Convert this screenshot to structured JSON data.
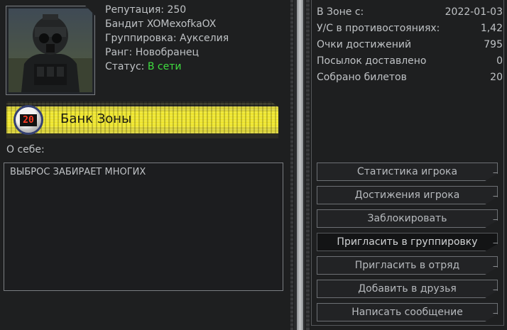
{
  "profile": {
    "reputation_label": "Репутация:",
    "reputation_value": "250",
    "name_line": "Бандит XOMexofkaOX",
    "faction_label": "Группировка:",
    "faction_value": "Аукселия",
    "rank_label": "Ранг:",
    "rank_value": "Новобранец",
    "status_label": "Статус:",
    "status_value": "В сети"
  },
  "bank": {
    "badge_number": "20",
    "label": "Банк Зоны"
  },
  "about": {
    "label": "О себе:",
    "text": "ВЫБРОС ЗАБИРАЕТ МНОГИХ"
  },
  "stats": [
    {
      "label": "В Зоне с:",
      "value": "2022-01-03"
    },
    {
      "label": "У/С в противостояниях:",
      "value": "1,42"
    },
    {
      "label": "Очки достижений",
      "value": "795"
    },
    {
      "label": "Посылок доставлено",
      "value": "0"
    },
    {
      "label": "Собрано билетов",
      "value": "20"
    }
  ],
  "actions": [
    {
      "label": "Статистика игрока"
    },
    {
      "label": "Достижения игрока"
    },
    {
      "label": "Заблокировать"
    },
    {
      "label": "Пригласить в группировку"
    },
    {
      "label": "Пригласить в отряд"
    },
    {
      "label": "Добавить в друзья"
    },
    {
      "label": "Написать сообщение"
    }
  ],
  "colors": {
    "status_online": "#3fdc3f",
    "banner_yellow": "#d9d13a",
    "badge_digits": "#ff3b24"
  }
}
